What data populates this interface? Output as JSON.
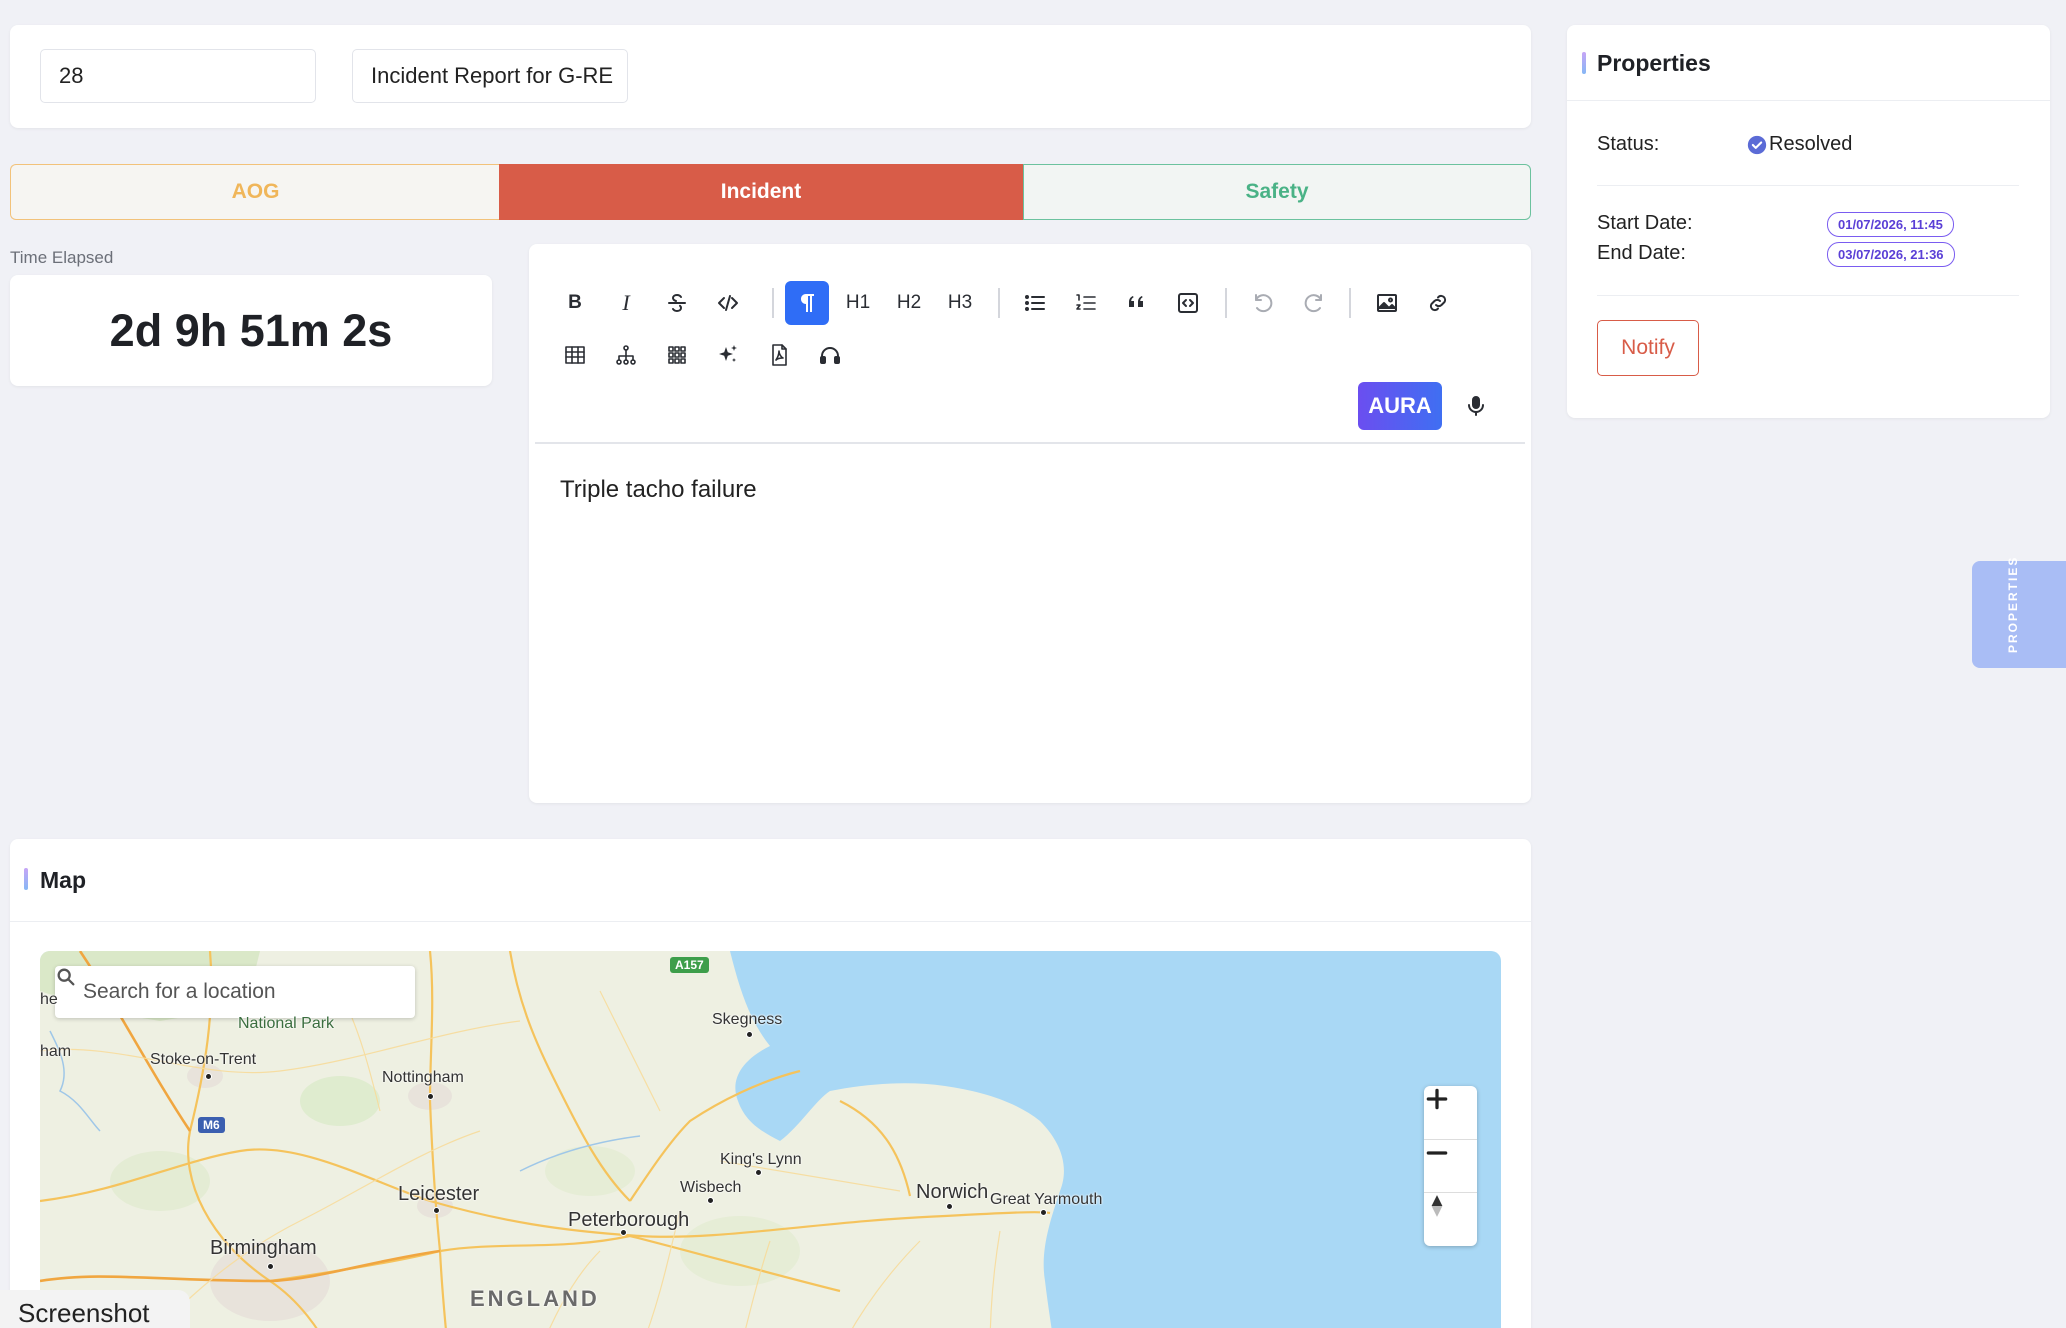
{
  "report": {
    "id_value": "28",
    "title_value": "Incident Report for G-RE"
  },
  "categories": [
    {
      "label": "AOG",
      "active": false
    },
    {
      "label": "Incident",
      "active": true
    },
    {
      "label": "Safety",
      "active": false
    }
  ],
  "time_elapsed": {
    "label": "Time Elapsed",
    "value": "2d 9h 51m 2s"
  },
  "editor": {
    "toolbar": {
      "bold": "B",
      "italic": "I",
      "h1": "H1",
      "h2": "H2",
      "h3": "H3",
      "aura_label": "AURA",
      "icons": [
        "bold-icon",
        "italic-icon",
        "strikethrough-icon",
        "code-icon",
        "paragraph-icon",
        "list-bullet-icon",
        "list-ordered-icon",
        "blockquote-icon",
        "code-block-icon",
        "undo-icon",
        "redo-icon",
        "image-icon",
        "link-icon",
        "table-icon",
        "hierarchy-icon",
        "grid-icon",
        "sparkle-icon",
        "pdf-icon",
        "headphones-icon",
        "microphone-icon"
      ]
    },
    "content": "Triple tacho failure"
  },
  "map": {
    "title": "Map",
    "search_placeholder": "Search for a location",
    "labels": {
      "skegness": "Skegness",
      "stoke": "Stoke-on-Trent",
      "nottingham": "Nottingham",
      "kings_lynn": "King's Lynn",
      "wisbech": "Wisbech",
      "norwich": "Norwich",
      "great_yarmouth": "Great Yarmouth",
      "leicester": "Leicester",
      "peterborough": "Peterborough",
      "birmingham": "Birmingham",
      "england": "ENGLAND",
      "national_park": "National Park",
      "ham": "ham",
      "he": "he"
    },
    "road_badges": {
      "a157": "A157",
      "m6": "M6"
    },
    "colors": {
      "sea": "#a9d8f5",
      "land": "#eef0e2"
    }
  },
  "properties": {
    "title": "Properties",
    "status_label": "Status:",
    "status_value": "Resolved",
    "start_label": "Start Date:",
    "start_value": "01/07/2026, 11:45",
    "end_label": "End Date:",
    "end_value": "03/07/2026, 21:36",
    "notify_label": "Notify",
    "side_tab_label": "PROPERTIES"
  },
  "overlay": {
    "screenshot_label": "Screenshot"
  },
  "colors": {
    "incident": "#d85c48",
    "aog": "#f0b65a",
    "safety": "#4ab286",
    "accent_blue": "#2f6df6",
    "aura_gradient_start": "#6b4ef0",
    "aura_gradient_end": "#3f6ff2"
  }
}
